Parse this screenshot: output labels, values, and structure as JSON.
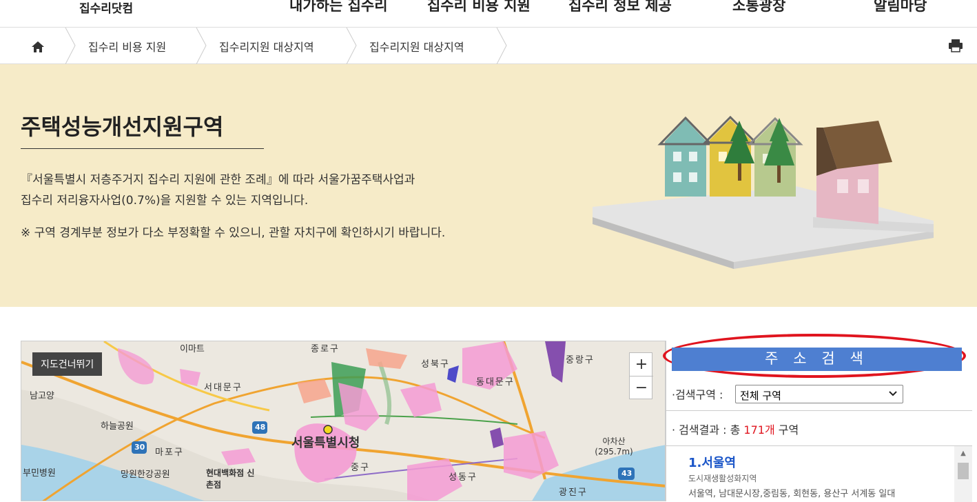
{
  "topnav": {
    "logo": "집수리닷컴",
    "menu": [
      "내가하는 집수리",
      "집수리 비용 지원",
      "집수리 정보 제공",
      "소통광장",
      "알림마당"
    ]
  },
  "breadcrumb": {
    "items": [
      "집수리 비용 지원",
      "집수리지원 대상지역",
      "집수리지원 대상지역"
    ]
  },
  "banner": {
    "title": "주택성능개선지원구역",
    "line1": "『서울특별시 저층주거지 집수리 지원에 관한 조례』에 따라 서울가꿈주택사업과",
    "line2": "집수리 저리융자사업(0.7%)을 지원할 수 있는 지역입니다.",
    "notice": "※ 구역 경계부분 정보가 다소 부정확할 수 있으니, 관할 자치구에 확인하시기 바랍니다."
  },
  "map": {
    "skip_label": "지도건너뛰기",
    "zoom_in": "+",
    "zoom_out": "−",
    "labels": [
      "이마트",
      "종로구",
      "성북구",
      "중랑구",
      "서대문구",
      "동대문구",
      "남고양",
      "하늘공원",
      "서울특별시청",
      "마포구",
      "아차산 (295.7m)",
      "망원한강공원",
      "현대백화점 신촌점",
      "성동구",
      "광진구",
      "중구",
      "48",
      "30",
      "43",
      "부민병원"
    ]
  },
  "panel": {
    "search_button": "주 소 검 색",
    "region_label": "·검색구역 :",
    "region_value": "전체 구역",
    "result_prefix": "· 검색결과 : 총 ",
    "result_count": "171개",
    "result_suffix": " 구역",
    "results": [
      {
        "title": "1.서울역",
        "category": "도시재생활성화지역",
        "desc": "서울역, 남대문시장,중림동, 회현동, 용산구 서계동 일대"
      }
    ]
  },
  "colors": {
    "banner_bg": "#f6ebc8",
    "search_button": "#4e7fd1",
    "highlight": "#e0141e",
    "result_title": "#1a55c8"
  }
}
